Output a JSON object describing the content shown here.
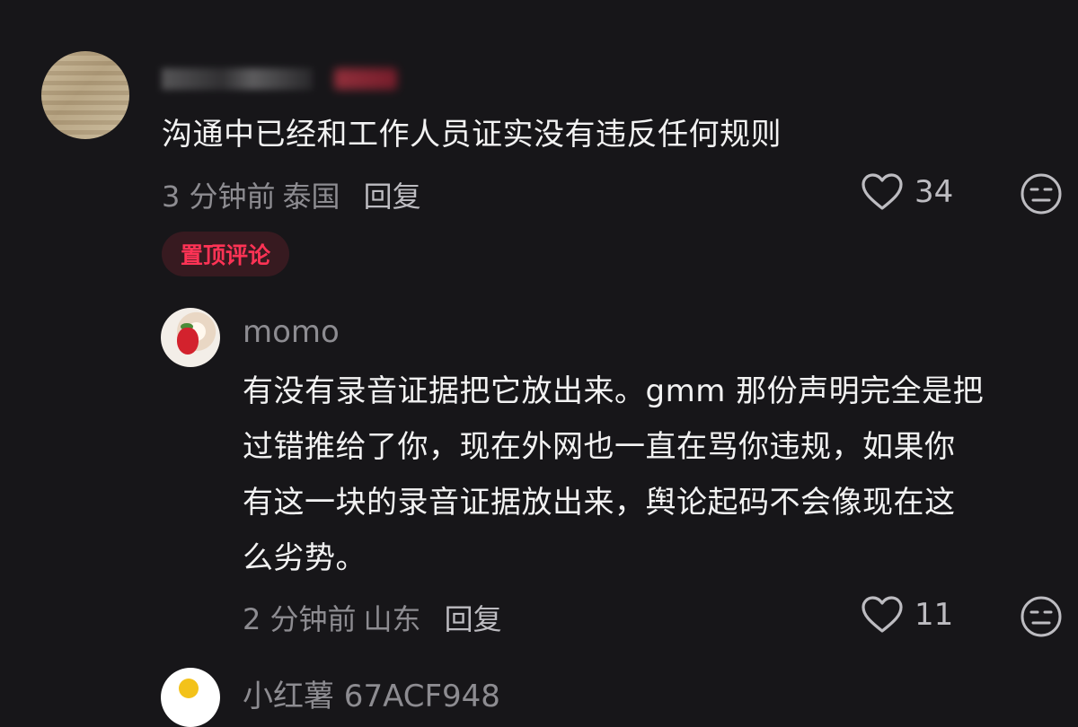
{
  "comments": [
    {
      "text": "沟通中已经和工作人员证实没有违反任何规则",
      "time": "3 分钟前",
      "location": "泰国",
      "reply_label": "回复",
      "likes": "34",
      "badge": "置顶评论"
    },
    {
      "username": "momo",
      "text_lines": [
        "有没有录音证据把它放出来。gmm 那份声明完全是把",
        "过错推给了你，现在外网也一直在骂你违规，如果你",
        "有这一块的录音证据放出来，舆论起码不会像现在这",
        "么劣势。"
      ],
      "time": "2 分钟前",
      "location": "山东",
      "reply_label": "回复",
      "likes": "11"
    },
    {
      "username": "小红薯 67ACF948"
    }
  ],
  "colors": {
    "background": "#171619",
    "badge_text": "#ff3355",
    "badge_bg": "#371a20",
    "meta": "#8d8c91"
  },
  "icons": [
    "heart-icon",
    "meh-face-icon"
  ]
}
